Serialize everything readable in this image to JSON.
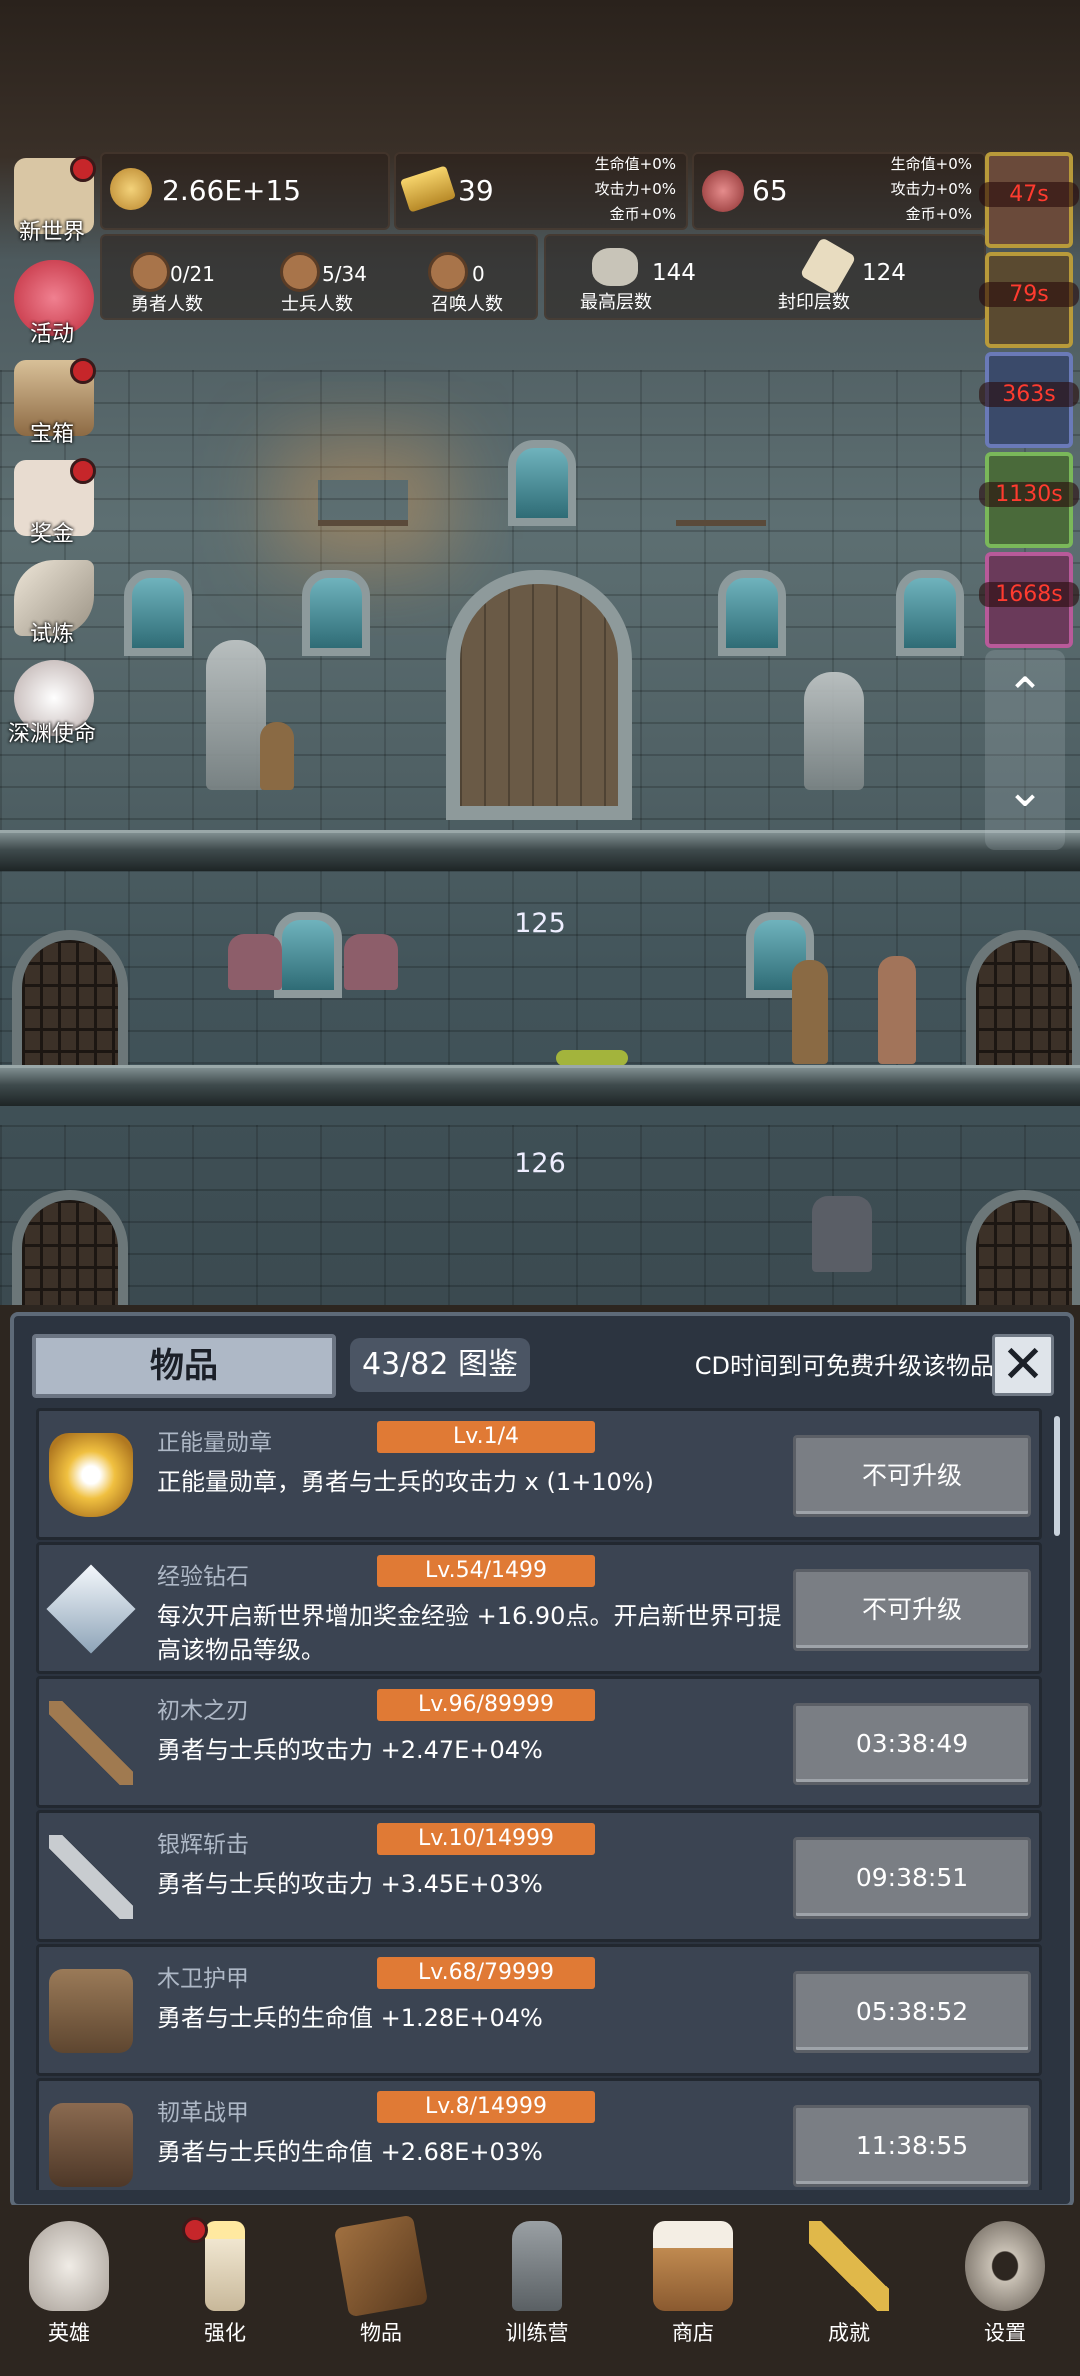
{
  "resources": {
    "gold": "2.66E+15",
    "gold_bar": "39",
    "gold_bar_bonus": [
      "生命值+0%",
      "攻击力+0%",
      "金币+0%"
    ],
    "meat": "65",
    "meat_bonus": [
      "生命值+0%",
      "攻击力+0%",
      "金币+0%"
    ]
  },
  "counts": {
    "heroes": {
      "value": "0/21",
      "label": "勇者人数"
    },
    "soldiers": {
      "value": "5/34",
      "label": "士兵人数"
    },
    "summons": {
      "value": "0",
      "label": "召唤人数"
    },
    "highest": {
      "value": "144",
      "label": "最高层数"
    },
    "sealed": {
      "value": "124",
      "label": "封印层数"
    }
  },
  "left_menu": [
    {
      "label": "新世界",
      "badge": true
    },
    {
      "label": "活动",
      "badge": false
    },
    {
      "label": "宝箱",
      "badge": true
    },
    {
      "label": "奖金",
      "badge": true
    },
    {
      "label": "试炼",
      "badge": false
    },
    {
      "label": "深渊使命",
      "badge": false
    }
  ],
  "timers": [
    "47s",
    "79s",
    "363s",
    "1130s",
    "1668s"
  ],
  "floors": [
    "125",
    "126"
  ],
  "panel": {
    "title": "物品",
    "collection": "43/82 图鉴",
    "hint": "CD时间到可免费升级该物品",
    "close": "✕"
  },
  "items": [
    {
      "name": "正能量勋章",
      "level": "Lv.1/4",
      "desc": "正能量勋章，勇者与士兵的攻击力 x (1+10%)",
      "action": "不可升级",
      "icon": "crown-icon"
    },
    {
      "name": "经验钻石",
      "level": "Lv.54/1499",
      "desc": "每次开启新世界增加奖金经验 +16.90点。开启新世界可提高该物品等级。",
      "action": "不可升级",
      "icon": "diamond-icon"
    },
    {
      "name": "初木之刃",
      "level": "Lv.96/89999",
      "desc": "勇者与士兵的攻击力 +2.47E+04%",
      "action": "03:38:49",
      "icon": "wooden-sword-icon"
    },
    {
      "name": "银辉斩击",
      "level": "Lv.10/14999",
      "desc": "勇者与士兵的攻击力 +3.45E+03%",
      "action": "09:38:51",
      "icon": "silver-sword-icon"
    },
    {
      "name": "木卫护甲",
      "level": "Lv.68/79999",
      "desc": "勇者与士兵的生命值 +1.28E+04%",
      "action": "05:38:52",
      "icon": "wooden-armor-icon"
    },
    {
      "name": "韧革战甲",
      "level": "Lv.8/14999",
      "desc": "勇者与士兵的生命值 +2.68E+03%",
      "action": "11:38:55",
      "icon": "leather-armor-icon"
    }
  ],
  "nav": [
    {
      "label": "英雄",
      "icon": "skull-icon",
      "badge": false
    },
    {
      "label": "强化",
      "icon": "candle-icon",
      "badge": true
    },
    {
      "label": "物品",
      "icon": "book-icon",
      "badge": false
    },
    {
      "label": "训练营",
      "icon": "lantern-icon",
      "badge": false
    },
    {
      "label": "商店",
      "icon": "mug-icon",
      "badge": false
    },
    {
      "label": "成就",
      "icon": "key-icon",
      "badge": false
    },
    {
      "label": "设置",
      "icon": "gear-icon",
      "badge": false
    }
  ]
}
